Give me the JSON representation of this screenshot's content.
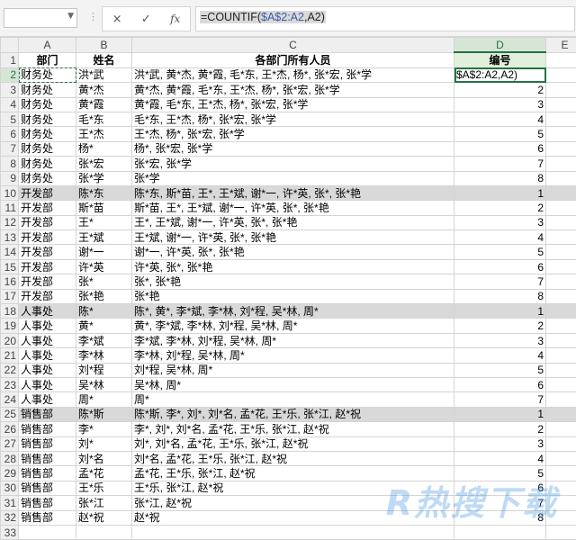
{
  "formula_bar": {
    "name_box": "",
    "cancel_icon": "×",
    "confirm_icon": "✓",
    "fx_label": "fx",
    "formula_prefix": "=COUNTIF(",
    "formula_ref": "$A$2:A2",
    "formula_suffix": ",A2)"
  },
  "columns": [
    "A",
    "B",
    "C",
    "D",
    "E"
  ],
  "headers": [
    "部门",
    "姓名",
    "各部门所有人员",
    "编号"
  ],
  "active_cell_text": "$A$2:A2,A2)",
  "rows": [
    {
      "n": "2",
      "dept": "财务处",
      "name": "洪*武",
      "all": "洪*武, 黄*杰, 黄*霞, 毛*东, 王*杰, 杨*, 张*宏, 张*学",
      "num": ""
    },
    {
      "n": "3",
      "dept": "财务处",
      "name": "黄*杰",
      "all": "黄*杰, 黄*霞, 毛*东, 王*杰, 杨*, 张*宏, 张*学",
      "num": "2"
    },
    {
      "n": "4",
      "dept": "财务处",
      "name": "黄*霞",
      "all": "黄*霞, 毛*东, 王*杰, 杨*, 张*宏, 张*学",
      "num": "3"
    },
    {
      "n": "5",
      "dept": "财务处",
      "name": "毛*东",
      "all": "毛*东, 王*杰, 杨*, 张*宏, 张*学",
      "num": "4"
    },
    {
      "n": "6",
      "dept": "财务处",
      "name": "王*杰",
      "all": "王*杰, 杨*, 张*宏, 张*学",
      "num": "5"
    },
    {
      "n": "7",
      "dept": "财务处",
      "name": "杨*",
      "all": "杨*, 张*宏, 张*学",
      "num": "6"
    },
    {
      "n": "8",
      "dept": "财务处",
      "name": "张*宏",
      "all": "张*宏, 张*学",
      "num": "7"
    },
    {
      "n": "9",
      "dept": "财务处",
      "name": "张*学",
      "all": "张*学",
      "num": "8"
    },
    {
      "n": "10",
      "dept": "开发部",
      "name": "陈*东",
      "all": "陈*东, 斯*苗, 王*, 王*斌, 谢*一, 许*英, 张*, 张*艳",
      "num": "1"
    },
    {
      "n": "11",
      "dept": "开发部",
      "name": "斯*苗",
      "all": "斯*苗, 王*, 王*斌, 谢*一, 许*英, 张*, 张*艳",
      "num": "2"
    },
    {
      "n": "12",
      "dept": "开发部",
      "name": "王*",
      "all": "王*, 王*斌, 谢*一, 许*英, 张*, 张*艳",
      "num": "3"
    },
    {
      "n": "13",
      "dept": "开发部",
      "name": "王*斌",
      "all": "王*斌, 谢*一, 许*英, 张*, 张*艳",
      "num": "4"
    },
    {
      "n": "14",
      "dept": "开发部",
      "name": "谢*一",
      "all": "谢*一, 许*英, 张*, 张*艳",
      "num": "5"
    },
    {
      "n": "15",
      "dept": "开发部",
      "name": "许*英",
      "all": "许*英, 张*, 张*艳",
      "num": "6"
    },
    {
      "n": "16",
      "dept": "开发部",
      "name": "张*",
      "all": "张*, 张*艳",
      "num": "7"
    },
    {
      "n": "17",
      "dept": "开发部",
      "name": "张*艳",
      "all": "张*艳",
      "num": "8"
    },
    {
      "n": "18",
      "dept": "人事处",
      "name": "陈*",
      "all": "陈*, 黄*, 李*斌, 李*林, 刘*程, 吴*林, 周*",
      "num": "1"
    },
    {
      "n": "19",
      "dept": "人事处",
      "name": "黄*",
      "all": "黄*, 李*斌, 李*林, 刘*程, 吴*林, 周*",
      "num": "2"
    },
    {
      "n": "20",
      "dept": "人事处",
      "name": "李*斌",
      "all": "李*斌, 李*林, 刘*程, 吴*林, 周*",
      "num": "3"
    },
    {
      "n": "21",
      "dept": "人事处",
      "name": "李*林",
      "all": "李*林, 刘*程, 吴*林, 周*",
      "num": "4"
    },
    {
      "n": "22",
      "dept": "人事处",
      "name": "刘*程",
      "all": "刘*程, 吴*林, 周*",
      "num": "5"
    },
    {
      "n": "23",
      "dept": "人事处",
      "name": "吴*林",
      "all": "吴*林, 周*",
      "num": "6"
    },
    {
      "n": "24",
      "dept": "人事处",
      "name": "周*",
      "all": "周*",
      "num": "7"
    },
    {
      "n": "25",
      "dept": "销售部",
      "name": "陈*斯",
      "all": "陈*斯, 李*, 刘*, 刘*名, 孟*花, 王*乐, 张*江, 赵*祝",
      "num": "1"
    },
    {
      "n": "26",
      "dept": "销售部",
      "name": "李*",
      "all": "李*, 刘*, 刘*名, 孟*花, 王*乐, 张*江, 赵*祝",
      "num": "2"
    },
    {
      "n": "27",
      "dept": "销售部",
      "name": "刘*",
      "all": "刘*, 刘*名, 孟*花, 王*乐, 张*江, 赵*祝",
      "num": "3"
    },
    {
      "n": "28",
      "dept": "销售部",
      "name": "刘*名",
      "all": "刘*名, 孟*花, 王*乐, 张*江, 赵*祝",
      "num": "4"
    },
    {
      "n": "29",
      "dept": "销售部",
      "name": "孟*花",
      "all": "孟*花, 王*乐, 张*江, 赵*祝",
      "num": "5"
    },
    {
      "n": "30",
      "dept": "销售部",
      "name": "王*乐",
      "all": "王*乐, 张*江, 赵*祝",
      "num": "6"
    },
    {
      "n": "31",
      "dept": "销售部",
      "name": "张*江",
      "all": "张*江, 赵*祝",
      "num": "7"
    },
    {
      "n": "32",
      "dept": "销售部",
      "name": "赵*祝",
      "all": "赵*祝",
      "num": "8"
    },
    {
      "n": "33",
      "dept": "",
      "name": "",
      "all": "",
      "num": ""
    }
  ],
  "highlight_rows": [
    "10",
    "18",
    "25"
  ],
  "watermark": "R热搜下载"
}
